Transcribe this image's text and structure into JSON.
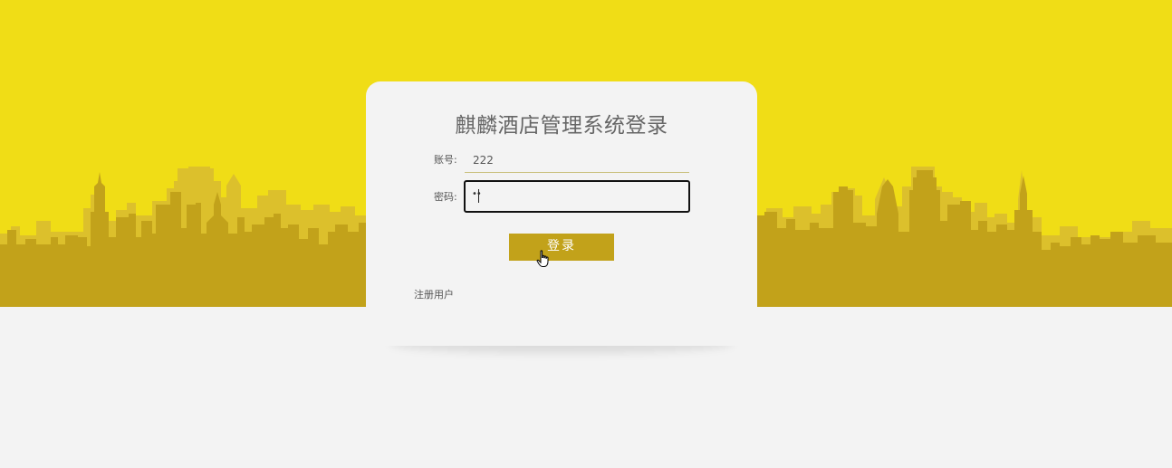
{
  "colors": {
    "banner": "#f0dd16",
    "skyline_dark": "#c2a21a",
    "skyline_light": "#dcc02c",
    "background": "#f3f3f3",
    "button": "#c2a21a"
  },
  "login": {
    "title": "麒麟酒店管理系统登录",
    "account_label": "账号:",
    "account_value": "222",
    "password_label": "密码:",
    "password_mask": "••",
    "submit_label": "登录",
    "register_link": "注册用户"
  },
  "icons": {
    "cursor": "hand-pointer-icon"
  }
}
